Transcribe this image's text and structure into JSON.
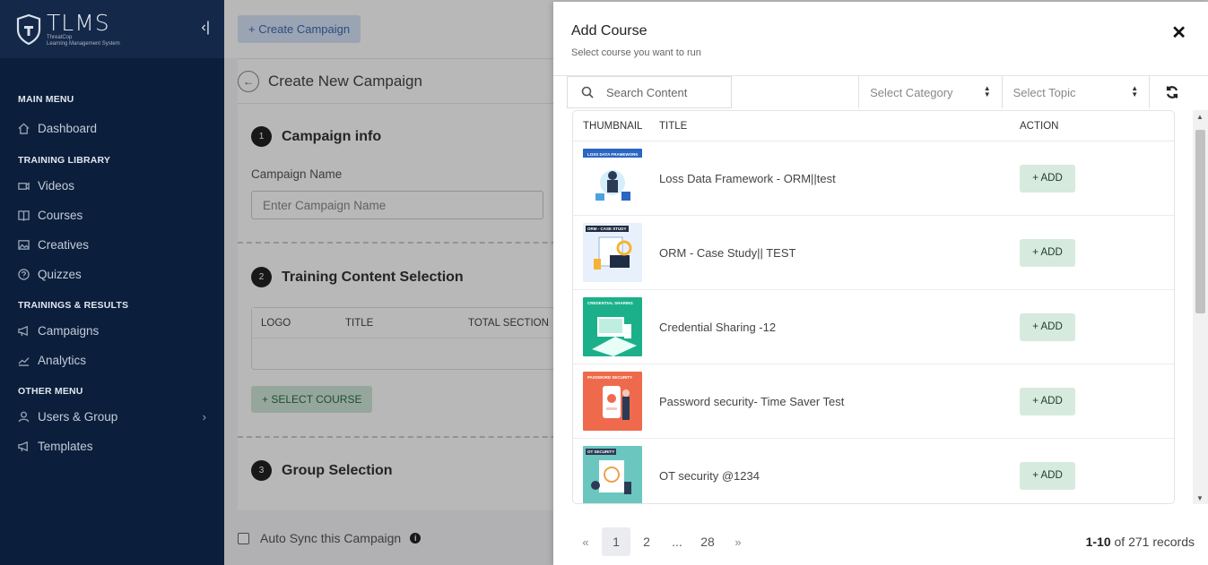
{
  "app": {
    "logo_title": "TLMS",
    "logo_sub_line1": "ThreatCop",
    "logo_sub_line2": "Learning Management System"
  },
  "sidebar": {
    "sections": [
      {
        "label": "MAIN MENU",
        "items": [
          {
            "label": "Dashboard",
            "icon": "home-icon"
          }
        ]
      },
      {
        "label": "TRAINING LIBRARY",
        "items": [
          {
            "label": "Videos",
            "icon": "video-icon"
          },
          {
            "label": "Courses",
            "icon": "book-icon"
          },
          {
            "label": "Creatives",
            "icon": "image-icon"
          },
          {
            "label": "Quizzes",
            "icon": "question-icon"
          }
        ]
      },
      {
        "label": "TRAININGS & RESULTS",
        "items": [
          {
            "label": "Campaigns",
            "icon": "megaphone-icon"
          },
          {
            "label": "Analytics",
            "icon": "chart-line-icon"
          }
        ]
      },
      {
        "label": "OTHER MENU",
        "items": [
          {
            "label": "Users & Group",
            "icon": "user-icon"
          },
          {
            "label": "Templates",
            "icon": "megaphone-icon"
          }
        ]
      }
    ]
  },
  "main": {
    "create_campaign_label": "+ Create Campaign",
    "page_title": "Create New Campaign",
    "step1": {
      "num": "1",
      "title": "Campaign info"
    },
    "campaign_name_label": "Campaign Name",
    "campaign_name_placeholder": "Enter Campaign Name",
    "step2": {
      "num": "2",
      "title": "Training Content Selection"
    },
    "mini_table_headers": [
      "LOGO",
      "TITLE",
      "TOTAL SECTION"
    ],
    "select_course_label": "+ SELECT COURSE",
    "step3": {
      "num": "3",
      "title": "Group Selection"
    },
    "auto_sync_label": "Auto Sync this Campaign"
  },
  "modal": {
    "title": "Add Course",
    "subtitle": "Select course you want to run",
    "search_placeholder": "Search Content",
    "category_placeholder": "Select Category",
    "topic_placeholder": "Select Topic",
    "columns": {
      "thumbnail": "THUMBNAIL",
      "title": "TITLE",
      "action": "ACTION"
    },
    "add_label": "+ ADD",
    "rows": [
      {
        "title": "Loss Data Framework - ORM||test",
        "thumb_label": "LOSS DATA FRAMEWORK - ORM",
        "thumb_color": "#ffffff"
      },
      {
        "title": "ORM - Case Study|| TEST",
        "thumb_label": "ORM - CASE STUDY",
        "thumb_color": "#e8f1fb"
      },
      {
        "title": "Credential Sharing -12",
        "thumb_label": "CREDENTIAL SHARING",
        "thumb_color": "#1bb08a"
      },
      {
        "title": "Password security- Time Saver Test",
        "thumb_label": "PASSWORD SECURITY",
        "thumb_color": "#ef6a4c"
      },
      {
        "title": "OT security @1234",
        "thumb_label": "OT SECURITY",
        "thumb_color": "#6cc6c0"
      }
    ],
    "pagination": {
      "prev": "«",
      "pages": [
        "1",
        "2",
        "...",
        "28"
      ],
      "next": "»",
      "active": "1"
    },
    "records_range": "1-10",
    "records_text": "of 271 records"
  },
  "colors": {
    "sidebar_bg": "#0b1e3b",
    "add_button_bg": "#d6eadd",
    "create_button_bg": "#d7e4f7"
  }
}
